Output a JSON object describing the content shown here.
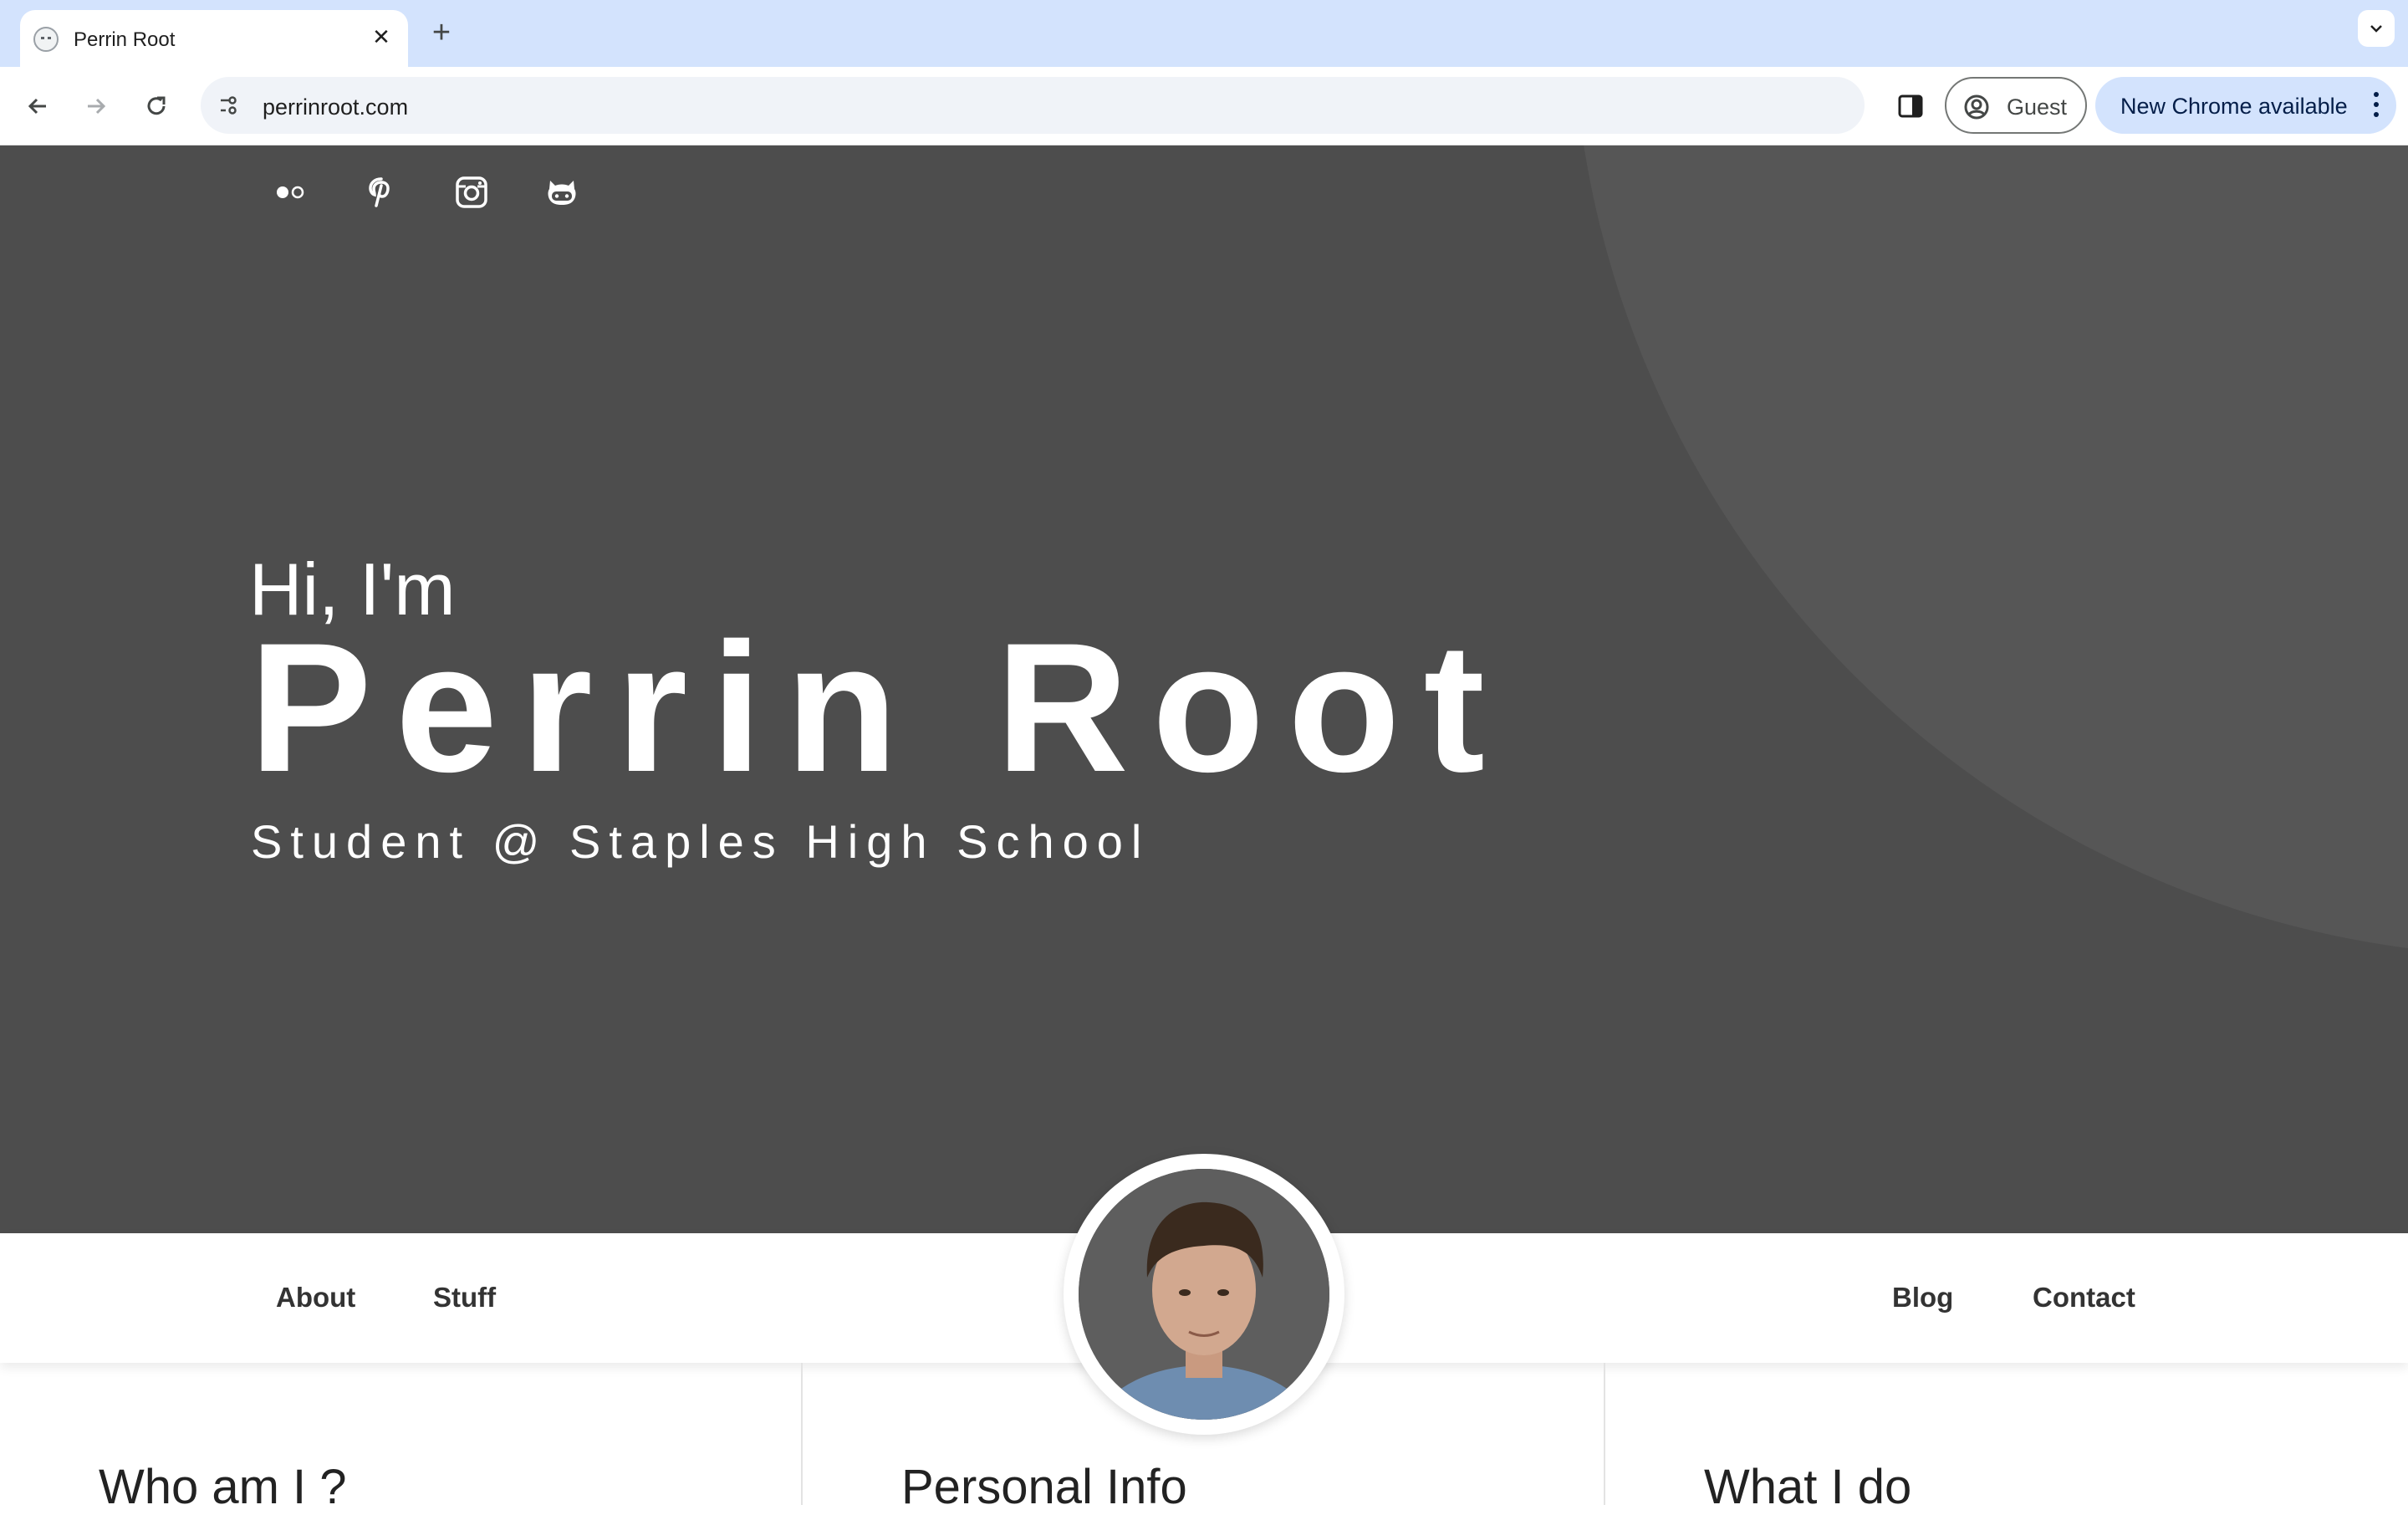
{
  "browser": {
    "tab_title": "Perrin Root",
    "url": "perrinroot.com",
    "guest_label": "Guest",
    "update_label": "New Chrome available"
  },
  "social_icons": [
    "flickr-icon",
    "pinterest-icon",
    "instagram-icon",
    "github-icon"
  ],
  "hero": {
    "greeting": "Hi, I'm",
    "name": "Perrin Root",
    "tagline": "Student @ Staples High School"
  },
  "nav": {
    "left": [
      "About",
      "Stuff"
    ],
    "right": [
      "Blog",
      "Contact"
    ]
  },
  "sections": [
    "Who am I ?",
    "Personal Info",
    "What I do"
  ],
  "colors": {
    "hero_bg": "#4d4d4d",
    "hero_accent": "#565656",
    "tabstrip_bg": "#d3e3fd"
  }
}
